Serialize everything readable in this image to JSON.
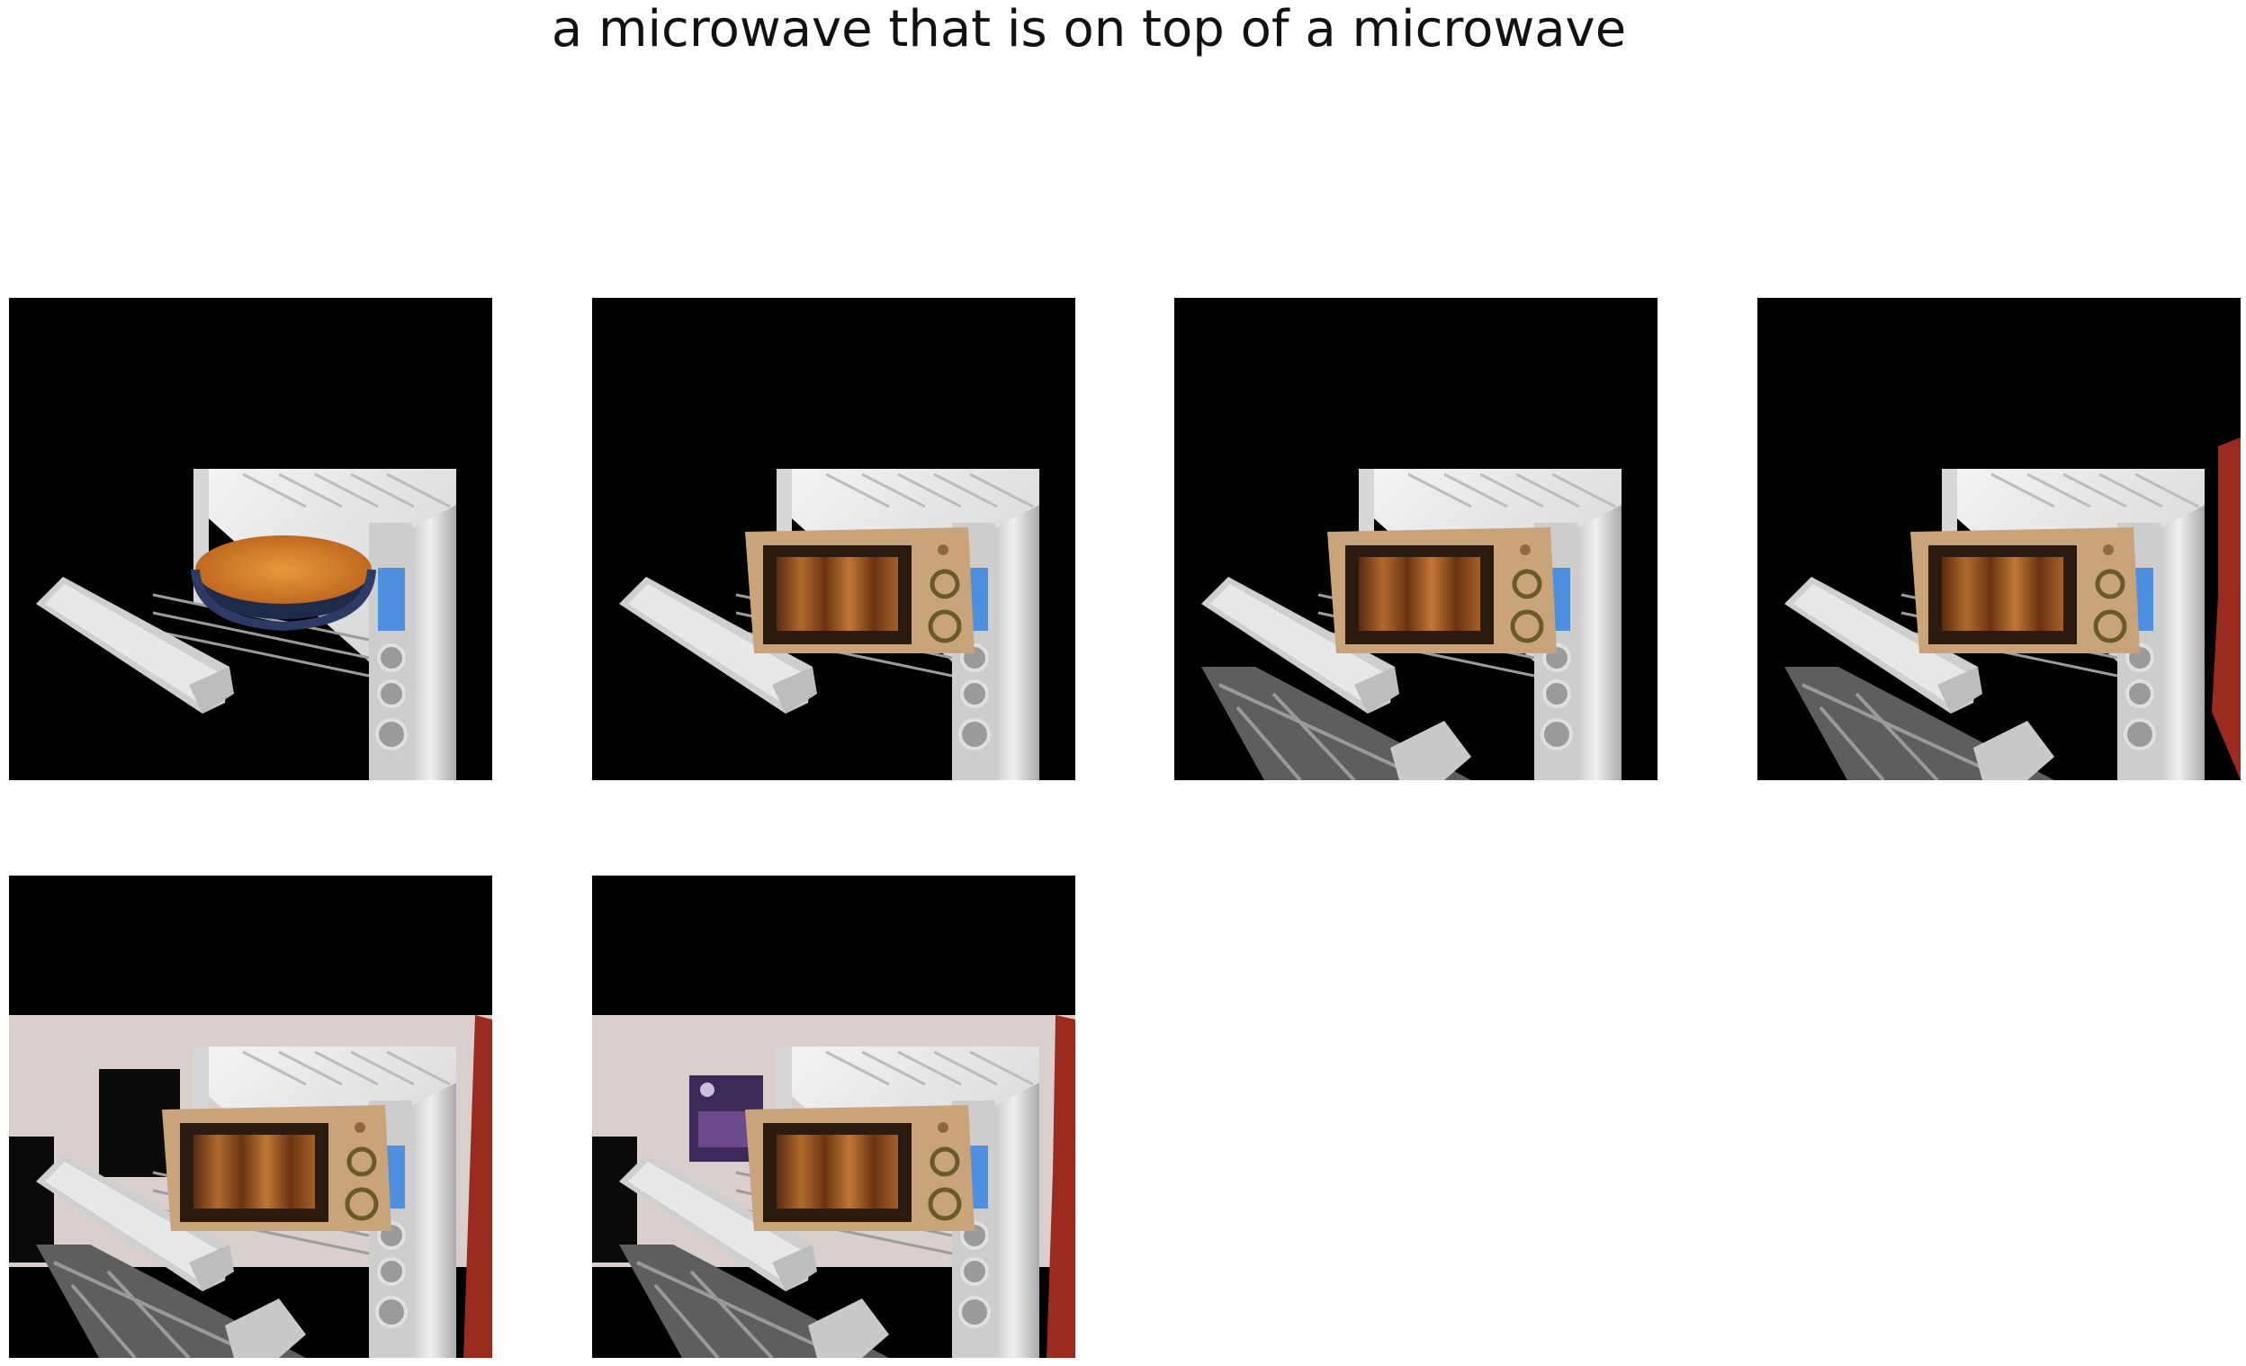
{
  "figure": {
    "title": "a microwave that is on top of a microwave"
  },
  "panels": [
    {
      "index": 1,
      "content": "toaster-oven-with-baked-dish"
    },
    {
      "index": 2,
      "content": "toaster-oven-with-small-microwave"
    },
    {
      "index": 3,
      "content": "toaster-oven-with-small-microwave-and-floor"
    },
    {
      "index": 4,
      "content": "toaster-oven-with-small-microwave-floor-and-red-edge"
    },
    {
      "index": 5,
      "content": "toaster-oven-with-small-microwave-and-room-wall"
    },
    {
      "index": 6,
      "content": "toaster-oven-with-small-microwave-room-wall-and-poster"
    }
  ],
  "colors": {
    "background": "#000000",
    "oven_body": "#e6e6e6",
    "microwave_body": "#c9a47a",
    "microwave_window": "#8a4a1e",
    "wall": "#d9cfcd",
    "accent_red": "#9b2b1e",
    "display_blue": "#4f8fe0"
  }
}
